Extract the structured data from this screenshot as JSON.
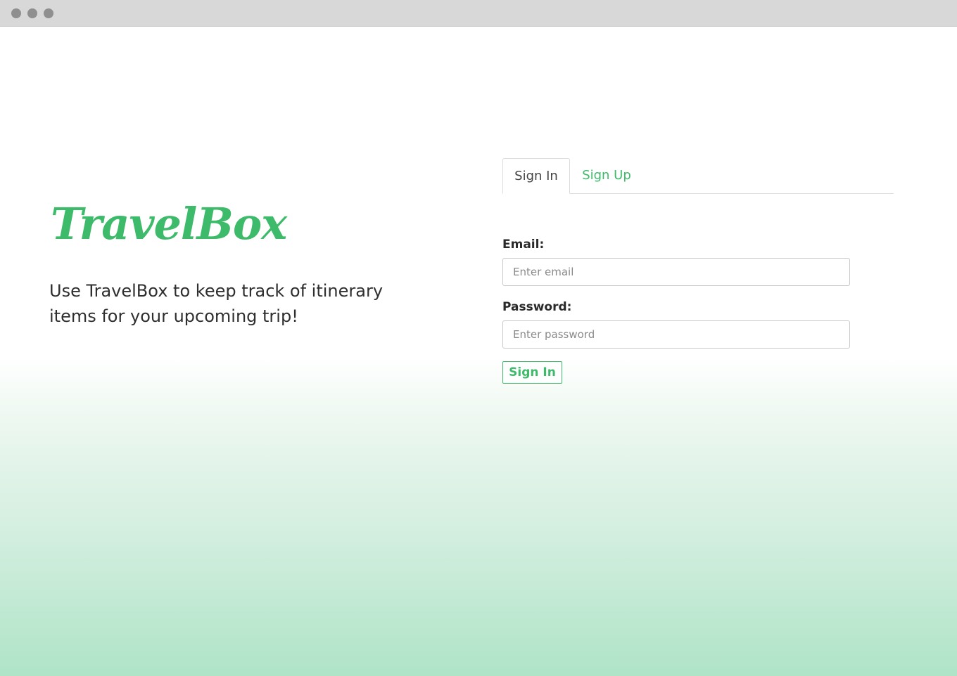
{
  "window": {
    "controls": [
      "window-dot",
      "window-dot",
      "window-dot"
    ]
  },
  "brand": {
    "logo_text": "TravelBox",
    "accent_color": "#3dba6a"
  },
  "hero": {
    "tagline": "Use TravelBox to keep track of itinerary items for your upcoming trip!"
  },
  "auth": {
    "tabs": [
      {
        "label": "Sign In",
        "active": true
      },
      {
        "label": "Sign Up",
        "active": false
      }
    ],
    "email_label": "Email:",
    "email_placeholder": "Enter email",
    "email_value": "",
    "password_label": "Password:",
    "password_placeholder": "Enter password",
    "password_value": "",
    "submit_label": "Sign In"
  }
}
